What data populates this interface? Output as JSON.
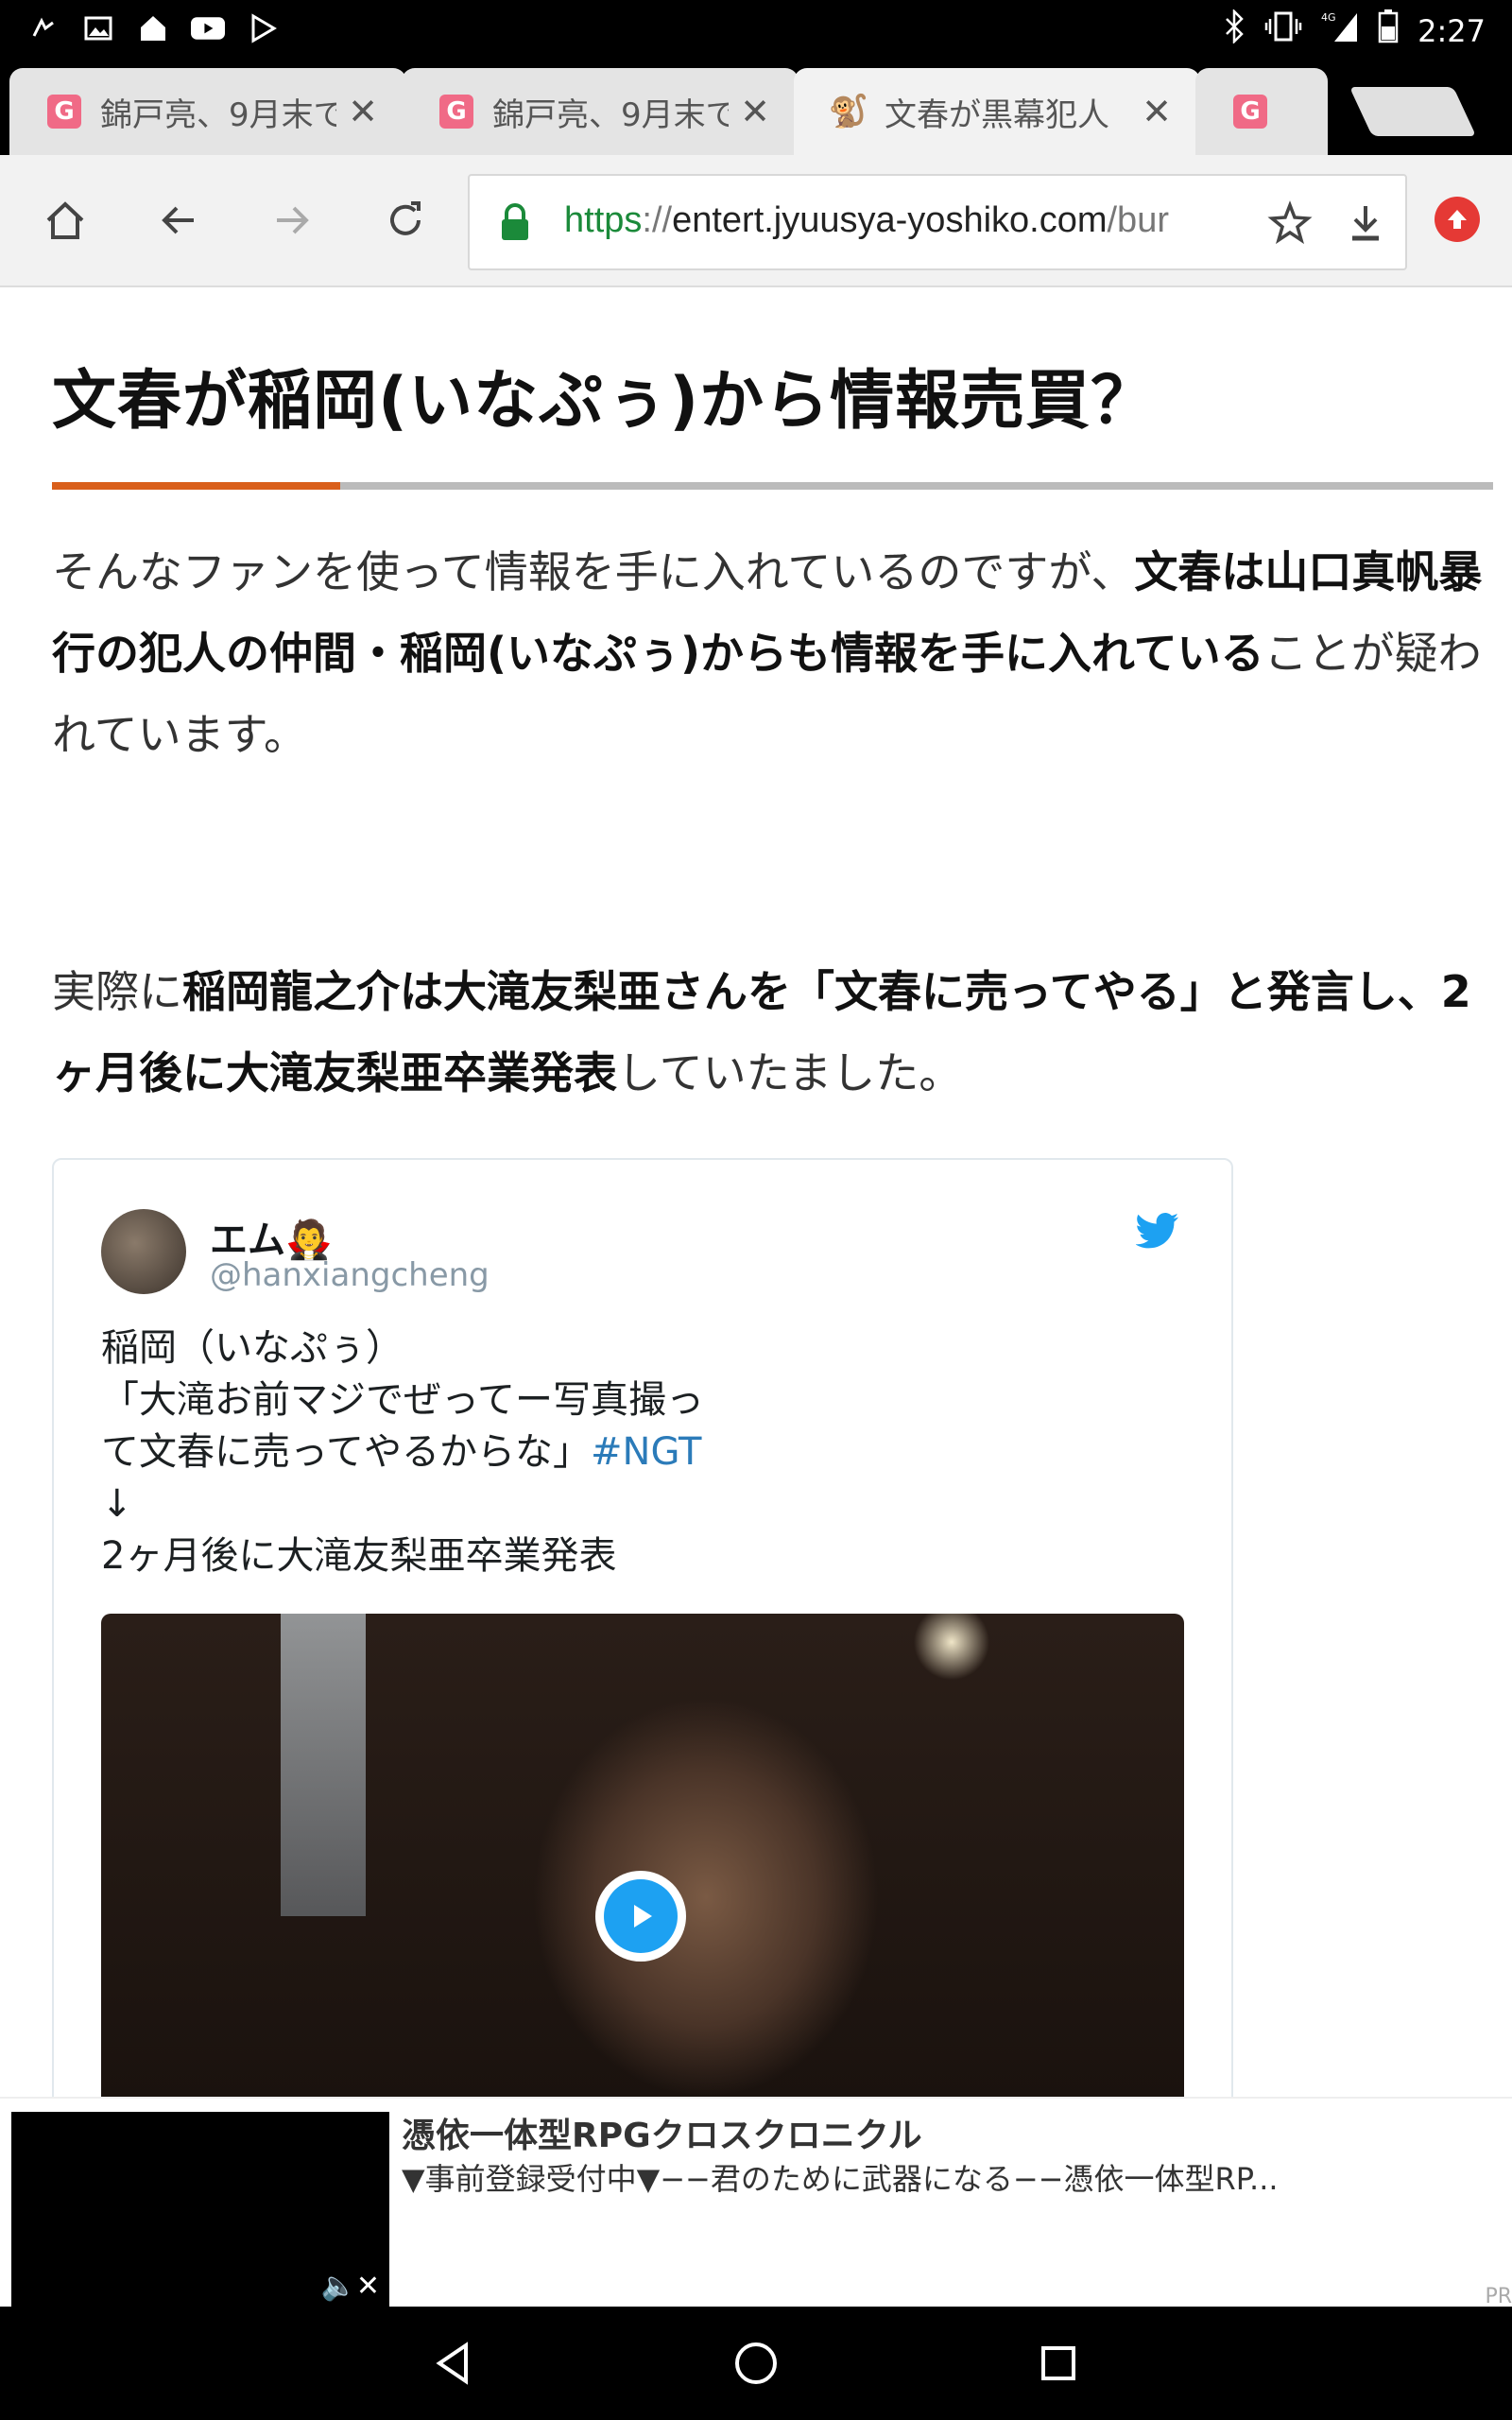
{
  "status_bar": {
    "time": "2:27",
    "network": "4G"
  },
  "tabs": [
    {
      "title": "錦戸亮、9月末で",
      "favicon": "G"
    },
    {
      "title": "錦戸亮、9月末で",
      "favicon": "G"
    },
    {
      "title": "文春が黒幕犯人",
      "favicon": "monkey-icon"
    },
    {
      "title": "",
      "favicon": "G"
    }
  ],
  "omnibox": {
    "scheme": "https",
    "separator": "://",
    "host": "entert.jyuusya-yoshiko.com",
    "path": "/bur"
  },
  "article": {
    "heading": "文春が稲岡(いなぷぅ)から情報売買？",
    "p1": {
      "lead": "そんなファンを使って情報を手に入れているのですが、",
      "bold": "文春は山口真帆暴行の犯人の仲間・稲岡(いなぷぅ)からも情報を手に入れている",
      "tail": "ことが疑われています。"
    },
    "p2": {
      "lead": "実際に",
      "bold1": "稲岡龍之介は大滝友梨亜さんを「文春に売ってやる」と発言し、2ヶ月後に大滝友梨亜卒業発表",
      "tail": "していたました。"
    }
  },
  "tweet": {
    "name": "エム🧛",
    "handle": "@hanxiangcheng",
    "line1": "稲岡（いなぷぅ）",
    "line2": "「大滝お前マジでぜってー写真撮っ",
    "line3": "て文春に売ってやるからな」",
    "hashtag": "#NGT",
    "line4": "↓",
    "line5": "2ヶ月後に大滝友梨亜卒業発表"
  },
  "ad": {
    "title": "憑依一体型RPGクロスクロニクル",
    "description": "▼事前登録受付中▼−−君のために武器になる−−憑依一体型RP...",
    "mark": "PR"
  },
  "colors": {
    "accent_rule": "#d95f1b",
    "link": "#2b7bb9",
    "secure_green": "#1b8a3a",
    "twitter_blue": "#1da1f2"
  }
}
